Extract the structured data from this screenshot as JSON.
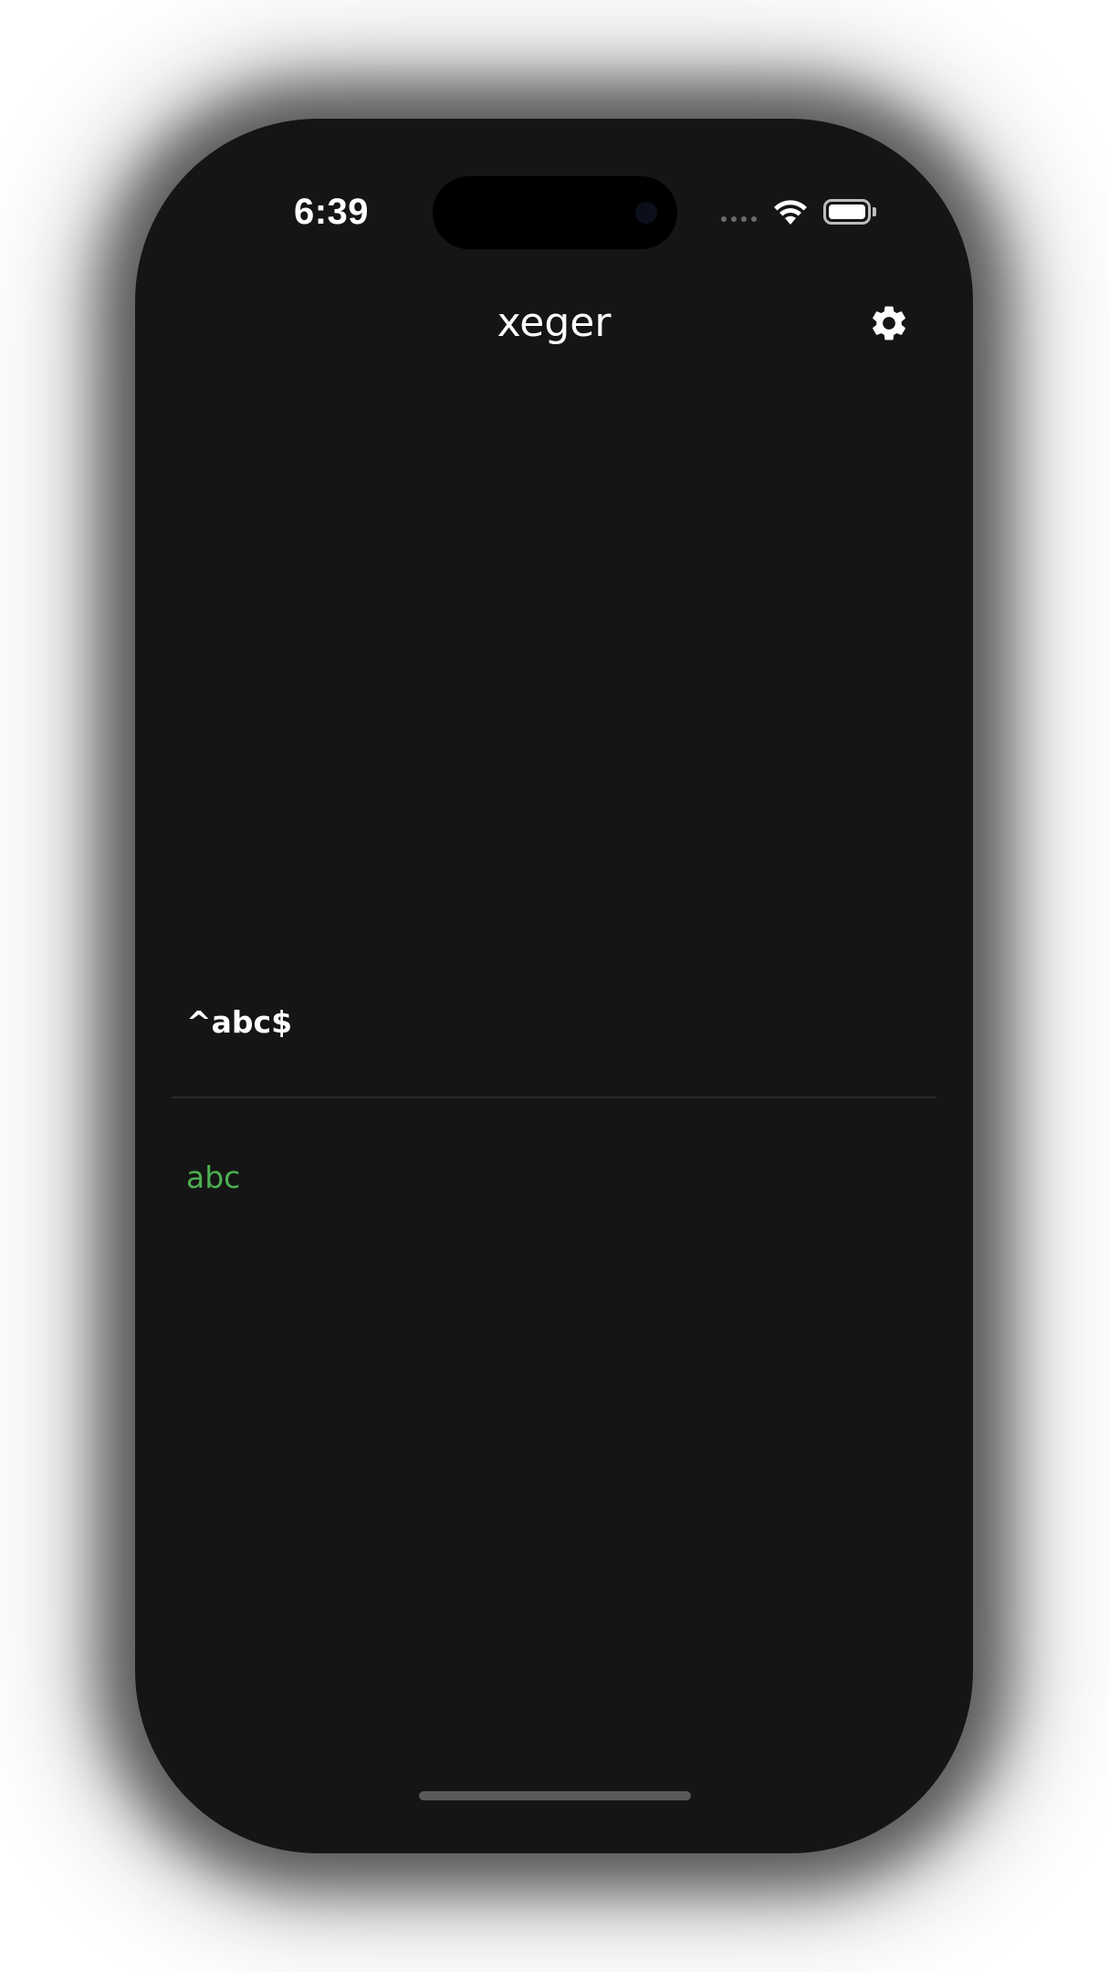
{
  "status_bar": {
    "time": "6:39"
  },
  "header": {
    "title": "xeger",
    "settings_icon": "gear-icon"
  },
  "editor": {
    "regex": "^abc$"
  },
  "result": {
    "match": "abc",
    "match_color": "#4caf50"
  },
  "colors": {
    "background": "#151515",
    "text": "#ffffff",
    "divider": "#2a2a2a"
  }
}
